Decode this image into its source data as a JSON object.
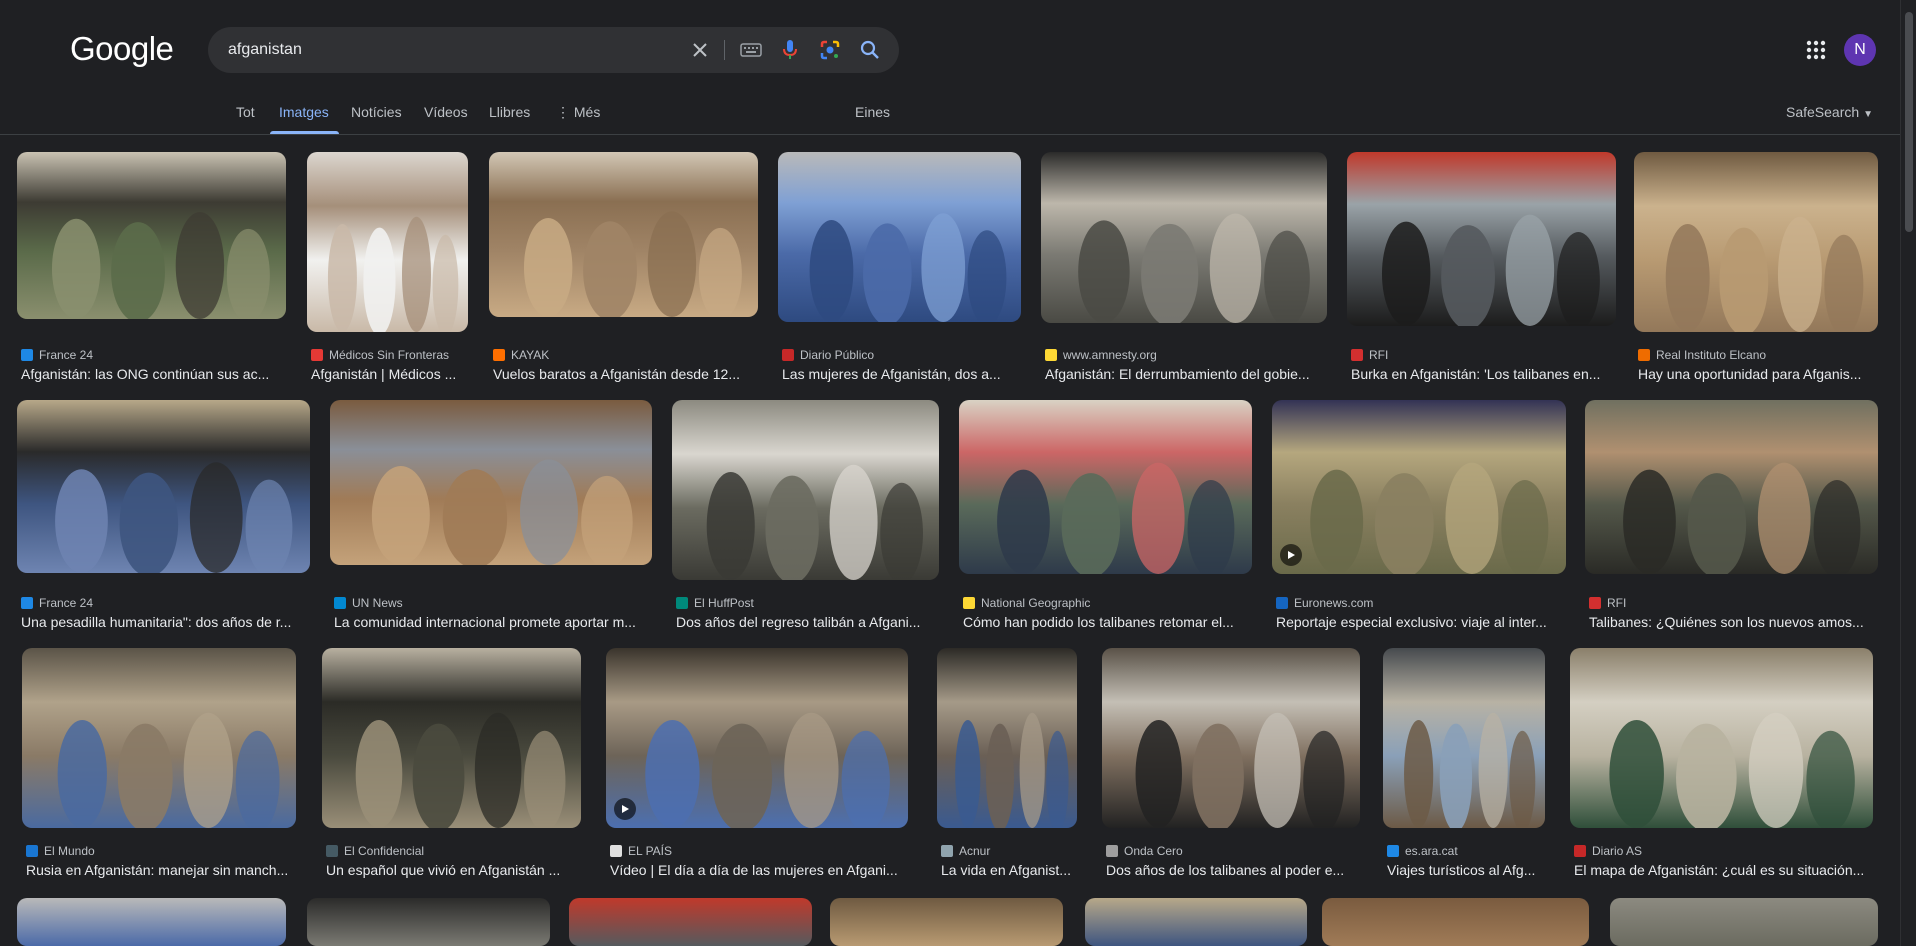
{
  "header": {
    "logo": "Google",
    "query": "afganistan",
    "avatar_letter": "N"
  },
  "tabs": [
    {
      "label": "Tot"
    },
    {
      "label": "Imatges"
    },
    {
      "label": "Notícies"
    },
    {
      "label": "Vídeos"
    },
    {
      "label": "Llibres"
    },
    {
      "label": "Més"
    },
    {
      "label": "Eines"
    }
  ],
  "safesearch": "SafeSearch",
  "results": [
    {
      "source": "France 24",
      "title": "Afganistán: las ONG continúan sus ac...",
      "fav": "#1e88e5"
    },
    {
      "source": "Médicos Sin Fronteras",
      "title": "Afganistán | Médicos ...",
      "fav": "#e53935"
    },
    {
      "source": "KAYAK",
      "title": "Vuelos baratos a Afganistán desde 12...",
      "fav": "#ff6f00"
    },
    {
      "source": "Diario Público",
      "title": "Las mujeres de Afganistán, dos a...",
      "fav": "#c62828"
    },
    {
      "source": "www.amnesty.org",
      "title": "Afganistán: El derrumbamiento del gobie...",
      "fav": "#fdd835"
    },
    {
      "source": "RFI",
      "title": "Burka en Afganistán: 'Los talibanes en...",
      "fav": "#d32f2f"
    },
    {
      "source": "Real Instituto Elcano",
      "title": "Hay una oportunidad para Afganis...",
      "fav": "#ef6c00"
    },
    {
      "source": "France 24",
      "title": "Una pesadilla humanitaria\": dos años de r...",
      "fav": "#1e88e5"
    },
    {
      "source": "UN News",
      "title": "La comunidad internacional promete aportar m...",
      "fav": "#0288d1"
    },
    {
      "source": "El HuffPost",
      "title": "Dos años del regreso talibán a Afgani...",
      "fav": "#00897b"
    },
    {
      "source": "National Geographic",
      "title": "Cómo han podido los talibanes retomar el...",
      "fav": "#fdd835"
    },
    {
      "source": "Euronews.com",
      "title": "Reportaje especial exclusivo: viaje al inter...",
      "fav": "#1565c0"
    },
    {
      "source": "RFI",
      "title": "Talibanes: ¿Quiénes son los nuevos amos...",
      "fav": "#d32f2f"
    },
    {
      "source": "El Mundo",
      "title": "Rusia en Afganistán: manejar sin manch...",
      "fav": "#1976d2"
    },
    {
      "source": "El Confidencial",
      "title": "Un español que vivió en Afganistán ...",
      "fav": "#455a64"
    },
    {
      "source": "EL PAÍS",
      "title": "Vídeo | El día a día de las mujeres en Afgani...",
      "fav": "#e0e0e0"
    },
    {
      "source": "Acnur",
      "title": "La vida en Afganist...",
      "fav": "#90a4ae"
    },
    {
      "source": "Onda Cero",
      "title": "Dos años de los talibanes al poder e...",
      "fav": "#9e9e9e"
    },
    {
      "source": "es.ara.cat",
      "title": "Viajes turísticos al Afg...",
      "fav": "#1e88e5"
    },
    {
      "source": "Diario AS",
      "title": "El mapa de Afganistán: ¿cuál es su situación...",
      "fav": "#c62828"
    }
  ],
  "colors": {
    "bg": "#1f2023",
    "accent": "#8ab4f8",
    "text": "#e8eaed",
    "muted": "#bdc1c6"
  }
}
